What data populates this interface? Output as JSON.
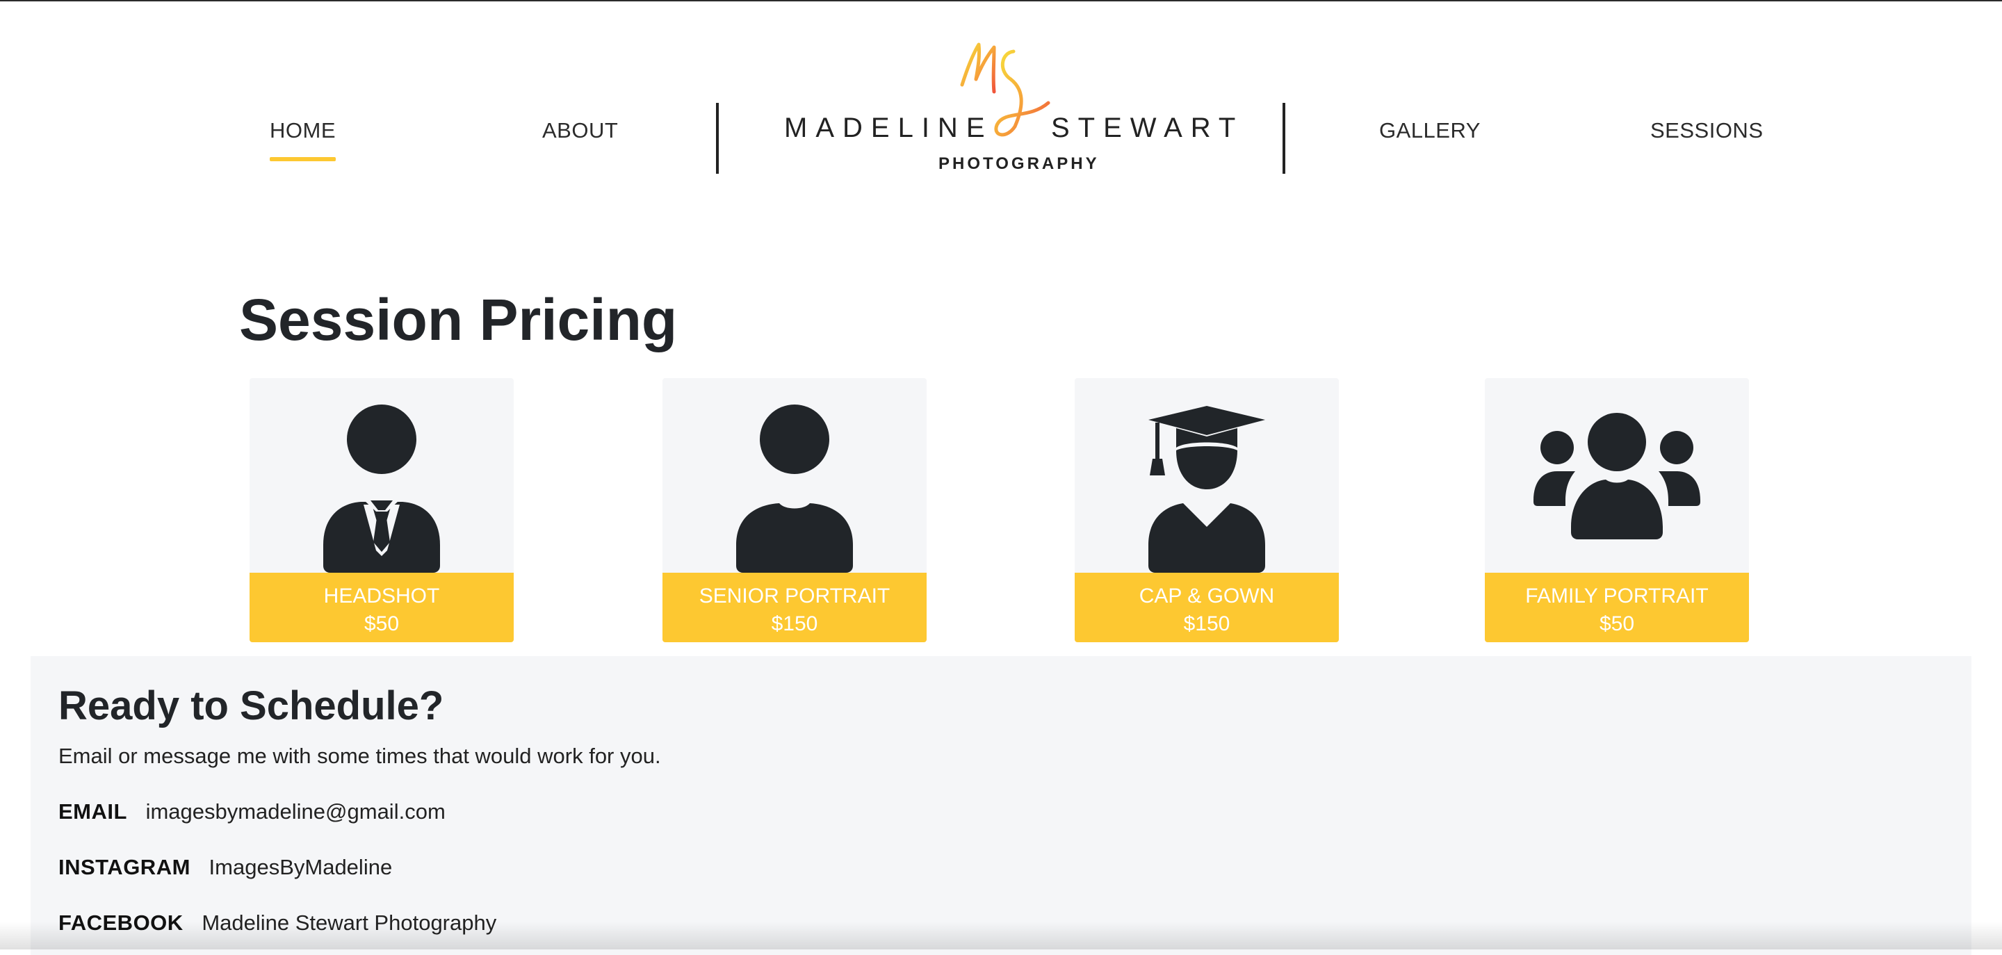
{
  "nav": {
    "items": [
      {
        "label": "HOME",
        "active": true
      },
      {
        "label": "ABOUT",
        "active": false
      },
      {
        "label": "GALLERY",
        "active": false
      },
      {
        "label": "SESSIONS",
        "active": false
      }
    ]
  },
  "logo": {
    "first_name": "MADELINE",
    "last_name": "STEWART",
    "subtitle": "PHOTOGRAPHY",
    "monogram": "MS"
  },
  "pricing": {
    "title": "Session Pricing",
    "cards": [
      {
        "name": "HEADSHOT",
        "price": "$50",
        "icon": "businessman-icon"
      },
      {
        "name": "SENIOR PORTRAIT",
        "price": "$150",
        "icon": "person-icon"
      },
      {
        "name": "CAP & GOWN",
        "price": "$150",
        "icon": "graduate-icon"
      },
      {
        "name": "FAMILY PORTRAIT",
        "price": "$50",
        "icon": "group-icon"
      }
    ]
  },
  "schedule": {
    "title": "Ready to Schedule?",
    "text": "Email or message me with some times that would work for you.",
    "contacts": [
      {
        "label": "EMAIL",
        "value": "imagesbymadeline@gmail.com"
      },
      {
        "label": "INSTAGRAM",
        "value": "ImagesByMadeline"
      },
      {
        "label": "FACEBOOK",
        "value": "Madeline Stewart Photography"
      }
    ]
  },
  "colors": {
    "accent": "#fdc831",
    "text_dark": "#222529",
    "card_bg": "#f5f6f8",
    "logo_gradient_start": "#f7d33b",
    "logo_gradient_end": "#f0543a"
  }
}
